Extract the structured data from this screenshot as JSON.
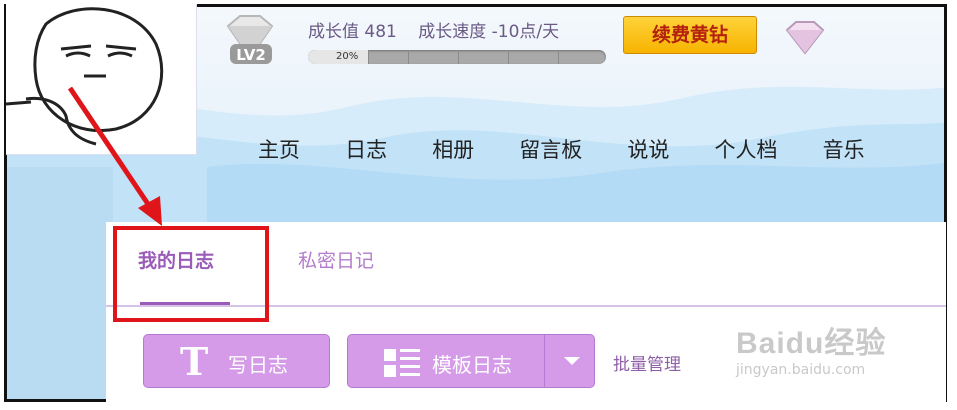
{
  "profile": {
    "level_badge": "LV2",
    "growth_value": "成长值 481",
    "growth_speed": "成长速度 -10点/天",
    "progress_percent": 20,
    "progress_label": "20%",
    "renew_button": "续费黄钻"
  },
  "nav": {
    "items": [
      "主页",
      "日志",
      "相册",
      "留言板",
      "说说",
      "个人档",
      "音乐"
    ]
  },
  "tabs": {
    "my_diary": "我的日志",
    "private_diary": "私密日记"
  },
  "actions": {
    "write_diary": "写日志",
    "template_diary": "模板日志",
    "batch_manage": "批量管理"
  },
  "watermark": {
    "logo": "Baidu经验",
    "url": "jingyan.baidu.com"
  },
  "colors": {
    "accent_purple": "#9b5bb8",
    "button_purple": "#d59be9",
    "annotation_red": "#e0151a",
    "renew_yellow": "#f7b300"
  }
}
